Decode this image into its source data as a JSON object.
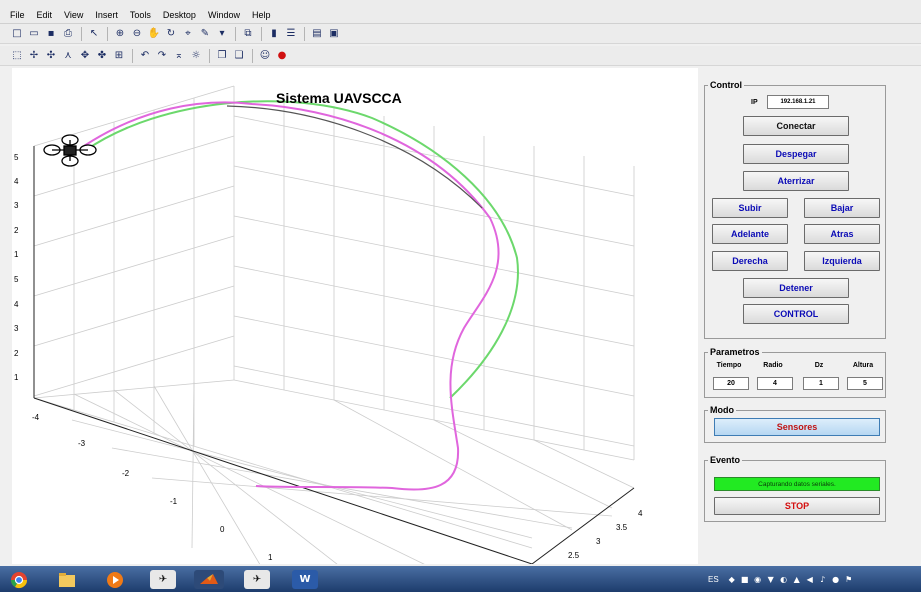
{
  "menubar": {
    "items": [
      "File",
      "Edit",
      "View",
      "Insert",
      "Tools",
      "Desktop",
      "Window",
      "Help"
    ]
  },
  "toolbar1": {
    "icons": [
      "new-file",
      "open-folder",
      "save",
      "print",
      "pointer",
      "zoom-in",
      "zoom-out",
      "pan",
      "rotate-3d",
      "data-cursor",
      "brush",
      "link",
      "colorbar",
      "legend",
      "hide-plot-tools",
      "show-plot-tools"
    ]
  },
  "toolbar2": {
    "icons": [
      "edit-plot",
      "select",
      "node",
      "connect",
      "move",
      "align",
      "grid",
      "undo-left",
      "undo-right",
      "dock",
      "light-bulb",
      "copy",
      "paste",
      "person",
      "stop"
    ]
  },
  "figure": {
    "title": "Sistema UAVSCCA",
    "z_ticks": [
      "1",
      "2",
      "3",
      "4",
      "5",
      "1",
      "2",
      "3",
      "4",
      "5"
    ],
    "y_ticks": [
      "-4",
      "-3",
      "-2",
      "-1",
      "0",
      "1"
    ],
    "x_ticks": [
      "4",
      "3.5",
      "3",
      "2.5"
    ],
    "colors": {
      "trajectory": "#e066dd",
      "reference": "#6cd86c",
      "grid": "#cccccc"
    }
  },
  "control": {
    "title": "Control",
    "ip_label": "IP",
    "ip_value": "192.168.1.21",
    "buttons": {
      "conectar": "Conectar",
      "despegar": "Despegar",
      "aterrizar": "Aterrizar",
      "subir": "Subir",
      "bajar": "Bajar",
      "adelante": "Adelante",
      "atras": "Atras",
      "derecha": "Derecha",
      "izquierda": "Izquierda",
      "detener": "Detener",
      "control": "CONTROL"
    }
  },
  "parametros": {
    "title": "Parametros",
    "headers": [
      "Tiempo",
      "Radio",
      "Dz",
      "Altura"
    ],
    "values": [
      "20",
      "4",
      "1",
      "5"
    ]
  },
  "modo": {
    "title": "Modo",
    "button": "Sensores"
  },
  "evento": {
    "title": "Evento",
    "status": "Capturando datos seriales.",
    "stop": "STOP",
    "status_color": "#22ea22"
  },
  "taskbar": {
    "lang": "ES",
    "apps": [
      "chrome",
      "file-explorer",
      "media-player",
      "dji-assistant",
      "matlab",
      "dji-app",
      "word"
    ]
  }
}
